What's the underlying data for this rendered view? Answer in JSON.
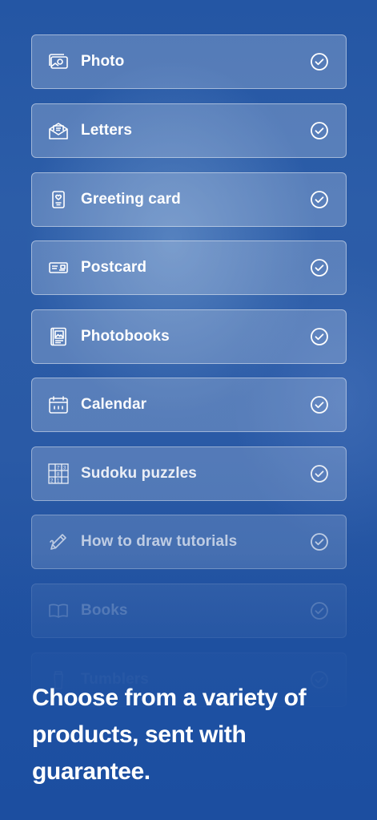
{
  "products": [
    {
      "label": "Photo",
      "icon": "photo-icon",
      "opacity": 1.0
    },
    {
      "label": "Letters",
      "icon": "letter-envelope-icon",
      "opacity": 1.0
    },
    {
      "label": "Greeting card",
      "icon": "greeting-card-icon",
      "opacity": 1.0
    },
    {
      "label": "Postcard",
      "icon": "postcard-icon",
      "opacity": 1.0
    },
    {
      "label": "Photobooks",
      "icon": "photobook-icon",
      "opacity": 1.0
    },
    {
      "label": "Calendar",
      "icon": "calendar-icon",
      "opacity": 0.97
    },
    {
      "label": "Sudoku puzzles",
      "icon": "sudoku-grid-icon",
      "opacity": 0.9
    },
    {
      "label": "How to draw tutorials",
      "icon": "pencil-draw-icon",
      "opacity": 0.7
    },
    {
      "label": "Books",
      "icon": "open-book-icon",
      "opacity": 0.35
    },
    {
      "label": "Tumblers",
      "icon": "tumbler-icon",
      "opacity": 0.15
    }
  ],
  "headline": "Choose from a variety of products, sent with guarantee.",
  "colors": {
    "background_top": "#2456a4",
    "background_bottom": "#1b4ea0",
    "text": "#ffffff",
    "card_fill": "rgba(255,255,255,0.22)"
  }
}
